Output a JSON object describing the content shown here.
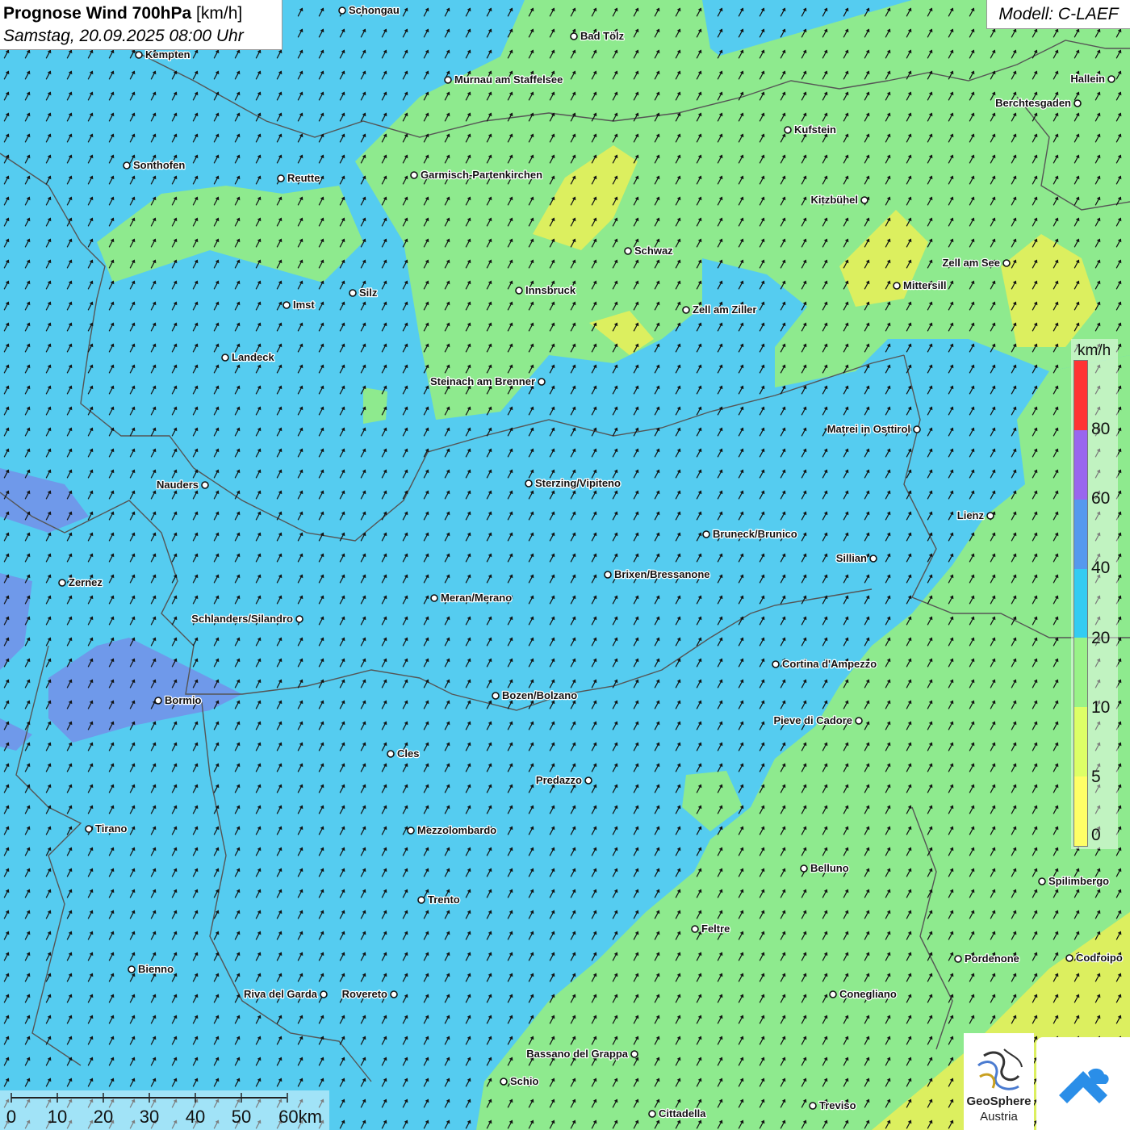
{
  "header": {
    "title": "Prognose Wind 700hPa",
    "unit": "[km/h]",
    "datetime": "Samstag, 20.09.2025 08:00 Uhr"
  },
  "model": "Modell: C-LAEF",
  "legend": {
    "unit": "km/h",
    "ticks": [
      "0",
      "5",
      "10",
      "20",
      "40",
      "60",
      "80"
    ],
    "colors": [
      "#ffff66",
      "#ddff66",
      "#99f288",
      "#33ccf2",
      "#5599ee",
      "#9966ee",
      "#ff3333"
    ]
  },
  "map_colors": {
    "calm": "#dcef5f",
    "light": "#8eea8e",
    "moderate": "#55ccf0",
    "fresh": "#6f99ea",
    "border": "#555555",
    "arrow": "#111111"
  },
  "wind_direction": "toward north-north-east",
  "cities": [
    {
      "name": "Schongau"
    },
    {
      "name": "Bad Tölz"
    },
    {
      "name": "Kempten"
    },
    {
      "name": "Murnau am Staffelsee"
    },
    {
      "name": "Hallein"
    },
    {
      "name": "Berchtesgaden"
    },
    {
      "name": "Kufstein"
    },
    {
      "name": "Sonthofen"
    },
    {
      "name": "Reutte"
    },
    {
      "name": "Garmisch-Partenkirchen"
    },
    {
      "name": "Kitzbühel"
    },
    {
      "name": "Schwaz"
    },
    {
      "name": "Zell am See"
    },
    {
      "name": "Mittersill"
    },
    {
      "name": "Imst"
    },
    {
      "name": "Silz"
    },
    {
      "name": "Innsbruck"
    },
    {
      "name": "Zell am Ziller"
    },
    {
      "name": "Landeck"
    },
    {
      "name": "Steinach am Brenner"
    },
    {
      "name": "Matrei in Osttirol"
    },
    {
      "name": "Nauders"
    },
    {
      "name": "Sterzing/Vipiteno"
    },
    {
      "name": "Lienz"
    },
    {
      "name": "Bruneck/Brunico"
    },
    {
      "name": "Sillian"
    },
    {
      "name": "Zernez"
    },
    {
      "name": "Brixen/Bressanone"
    },
    {
      "name": "Meran/Merano"
    },
    {
      "name": "Schlanders/Silandro"
    },
    {
      "name": "Cortina d'Ampezzo"
    },
    {
      "name": "Bormio"
    },
    {
      "name": "Bozen/Bolzano"
    },
    {
      "name": "Pieve di Cadore"
    },
    {
      "name": "Cles"
    },
    {
      "name": "Predazzo"
    },
    {
      "name": "Tirano"
    },
    {
      "name": "Mezzolombardo"
    },
    {
      "name": "Belluno"
    },
    {
      "name": "Spilimbergo"
    },
    {
      "name": "Trento"
    },
    {
      "name": "Feltre"
    },
    {
      "name": "Bienno"
    },
    {
      "name": "Pordenone"
    },
    {
      "name": "Codroipo"
    },
    {
      "name": "Riva del Garda"
    },
    {
      "name": "Rovereto"
    },
    {
      "name": "Conegliano"
    },
    {
      "name": "Bassano del Grappa"
    },
    {
      "name": "Schio"
    },
    {
      "name": "Treviso"
    },
    {
      "name": "Cittadella"
    }
  ],
  "scalebar": {
    "labels": [
      "0",
      "10",
      "20",
      "30",
      "40",
      "50",
      "60km"
    ]
  },
  "logo": {
    "line1": "GeoSphere",
    "line2": "Austria"
  }
}
